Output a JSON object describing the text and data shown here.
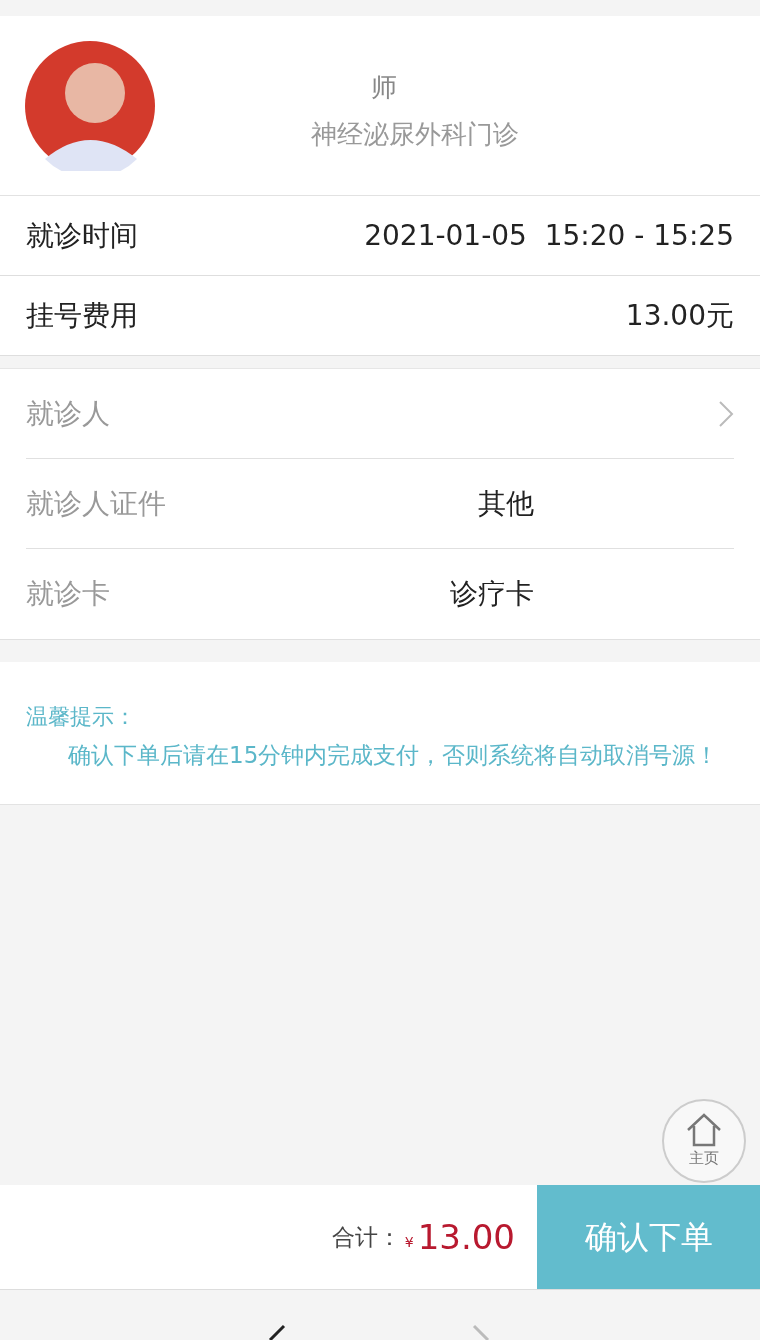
{
  "doctor": {
    "title_fragment": "师",
    "department": "神经泌尿外科门诊"
  },
  "summary_rows": [
    {
      "label": "就诊时间",
      "value": "2021-01-05  15:20 - 15:25"
    },
    {
      "label": "挂号费用",
      "value": "13.00元"
    }
  ],
  "patient_rows": [
    {
      "label": "就诊人",
      "chevron": true
    },
    {
      "label": "就诊人证件",
      "value": "其他",
      "chevron": false
    },
    {
      "label": "就诊卡",
      "value": "诊疗卡",
      "chevron": false
    }
  ],
  "notice": {
    "title": "温馨提示：",
    "text": "确认下单后请在15分钟内完成支付，否则系统将自动取消号源！"
  },
  "home_button": {
    "label": "主页"
  },
  "footer": {
    "total_label": "合计：",
    "currency": "¥",
    "total": "13.00",
    "confirm_button": "确认下单"
  }
}
